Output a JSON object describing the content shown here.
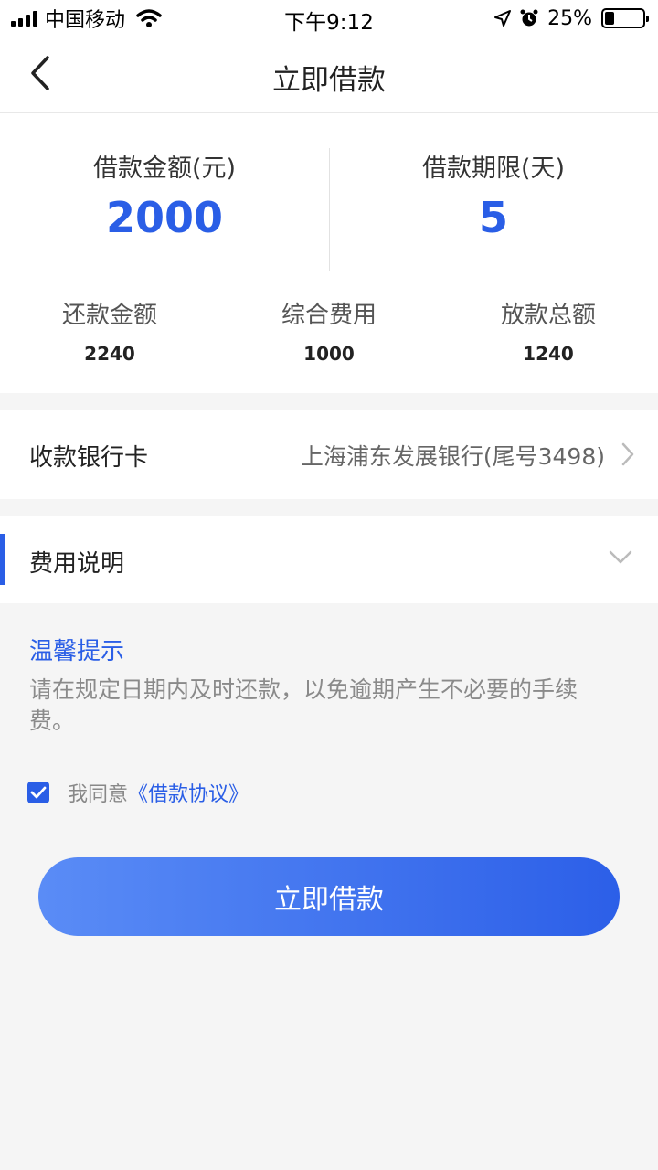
{
  "status_bar": {
    "carrier": "中国移动",
    "time": "下午9:12",
    "battery": "25%",
    "battery_level": 0.25
  },
  "nav": {
    "title": "立即借款",
    "back_icon": "chevron-left-icon"
  },
  "summary": {
    "amount_label": "借款金额(元)",
    "amount_value": "2000",
    "term_label": "借款期限(天)",
    "term_value": "5",
    "repay_label": "还款金额",
    "repay_value": "2240",
    "fee_label": "综合费用",
    "fee_value": "1000",
    "payout_label": "放款总额",
    "payout_value": "1240"
  },
  "bank": {
    "label": "收款银行卡",
    "value": "上海浦东发展银行(尾号3498)"
  },
  "fee_section": {
    "label": "费用说明"
  },
  "tips": {
    "title": "温馨提示",
    "text": "请在规定日期内及时还款，以免逾期产生不必要的手续 费。"
  },
  "agreement": {
    "checked": true,
    "prefix": "我同意",
    "link": "《借款协议》"
  },
  "submit": {
    "label": "立即借款"
  },
  "colors": {
    "accent": "#2a5ee6",
    "gradient_start": "#5a8cf6",
    "gradient_end": "#2c5fe8"
  }
}
